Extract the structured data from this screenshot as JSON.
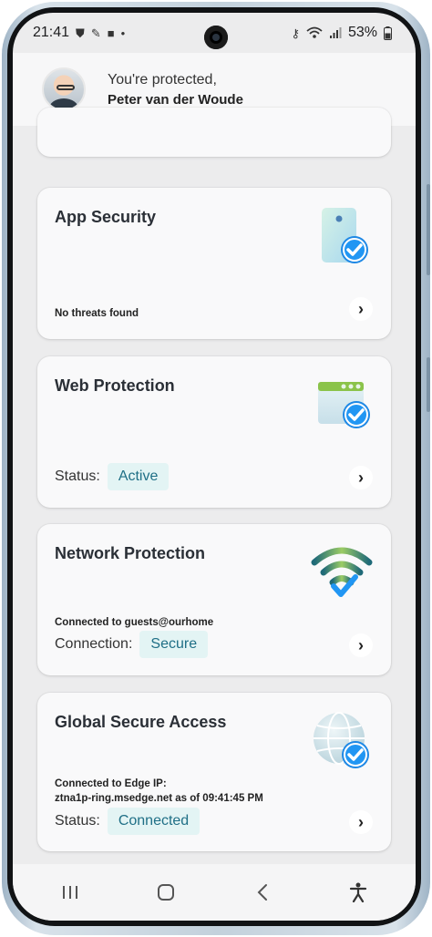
{
  "status_bar": {
    "time": "21:41",
    "battery": "53%",
    "left_icons": [
      "shield-icon",
      "wand-icon",
      "briefcase-icon",
      "dot-icon"
    ],
    "right_icons": [
      "key-icon",
      "wifi-icon",
      "signal-icon",
      "battery-icon"
    ]
  },
  "header": {
    "greeting": "You're protected,",
    "user_name": "Peter van der Woude"
  },
  "cards": [
    {
      "title": "App Security",
      "subtitle": "No threats found",
      "icon": "app-security-icon"
    },
    {
      "title": "Web Protection",
      "status_label": "Status:",
      "status_value": "Active",
      "icon": "web-protection-icon"
    },
    {
      "title": "Network Protection",
      "subtitle": "Connected to guests@ourhome",
      "status_label": "Connection:",
      "status_value": "Secure",
      "icon": "wifi-protection-icon"
    },
    {
      "title": "Global Secure Access",
      "subtitle_line1": "Connected to Edge IP:",
      "subtitle_line2": "ztna1p-ring.msedge.net as of 09:41:45 PM",
      "status_label": "Status:",
      "status_value": "Connected",
      "icon": "globe-icon"
    }
  ],
  "nav": [
    "recent-apps-icon",
    "home-icon",
    "back-icon",
    "accessibility-icon"
  ],
  "colors": {
    "pill_bg": "#e3f4f4",
    "pill_text": "#1f6f86",
    "accent_blue": "#1a73e8"
  }
}
